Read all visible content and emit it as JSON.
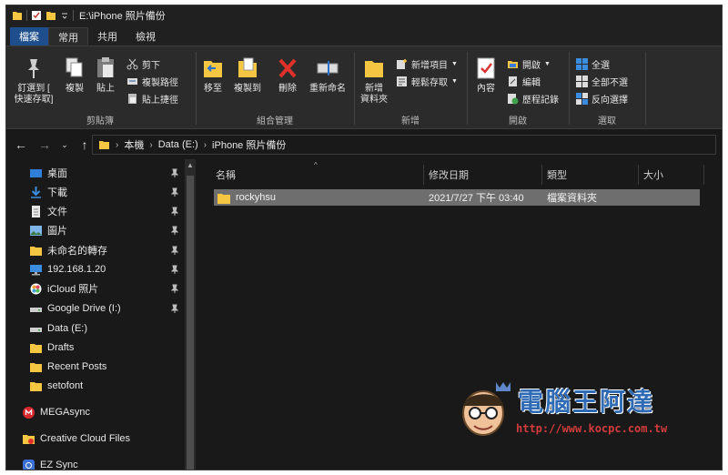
{
  "window": {
    "title": "E:\\iPhone 照片備份"
  },
  "tabs": [
    {
      "label": "檔案",
      "state": "file"
    },
    {
      "label": "常用",
      "state": "active"
    },
    {
      "label": "共用",
      "state": "normal"
    },
    {
      "label": "檢視",
      "state": "normal"
    }
  ],
  "ribbon": {
    "clipboard": {
      "pin_label_1": "釘選到 [",
      "pin_label_2": "快速存取]",
      "copy_label": "複製",
      "paste_label": "貼上",
      "cut_label": "剪下",
      "copy_path_label": "複製路徑",
      "paste_shortcut_label": "貼上捷徑",
      "group_label": "剪貼簿"
    },
    "organize": {
      "move_to_label": "移至",
      "copy_to_label": "複製到",
      "delete_label": "刪除",
      "rename_label": "重新命名",
      "group_label": "組合管理"
    },
    "new": {
      "new_folder_label_1": "新增",
      "new_folder_label_2": "資料夾",
      "new_item_label": "新增項目",
      "easy_access_label": "輕鬆存取",
      "group_label": "新增"
    },
    "open": {
      "properties_label": "內容",
      "open_label": "開啟",
      "edit_label": "編輯",
      "history_label": "歷程記錄",
      "group_label": "開啟"
    },
    "select": {
      "select_all_label": "全選",
      "select_none_label": "全部不選",
      "invert_label": "反向選擇",
      "group_label": "選取"
    }
  },
  "address": {
    "crumbs": [
      "本機",
      "Data (E:)",
      "iPhone 照片備份"
    ]
  },
  "navpane": {
    "items": [
      {
        "label": "桌面",
        "icon": "desktop-icon",
        "pinned": true
      },
      {
        "label": "下載",
        "icon": "download-icon",
        "pinned": true
      },
      {
        "label": "文件",
        "icon": "document-icon",
        "pinned": true
      },
      {
        "label": "圖片",
        "icon": "picture-icon",
        "pinned": true
      },
      {
        "label": "未命名的轉存",
        "icon": "folder-icon",
        "pinned": true
      },
      {
        "label": "192.168.1.20",
        "icon": "network-drive-icon",
        "pinned": true
      },
      {
        "label": "iCloud 照片",
        "icon": "icloud-photos-icon",
        "pinned": true
      },
      {
        "label": "Google Drive (I:)",
        "icon": "drive-icon",
        "pinned": true
      },
      {
        "label": "Data (E:)",
        "icon": "drive-icon",
        "pinned": false
      },
      {
        "label": "Drafts",
        "icon": "folder-icon",
        "pinned": false
      },
      {
        "label": "Recent Posts",
        "icon": "folder-icon",
        "pinned": false
      },
      {
        "label": "setofont",
        "icon": "folder-icon",
        "pinned": false
      },
      {
        "label": "MEGAsync",
        "icon": "mega-icon",
        "pinned": false
      },
      {
        "label": "Creative Cloud Files",
        "icon": "creative-cloud-icon",
        "pinned": false
      },
      {
        "label": "EZ Sync",
        "icon": "ez-sync-icon",
        "pinned": false
      }
    ]
  },
  "columns": {
    "name": "名稱",
    "modified": "修改日期",
    "type": "類型",
    "size": "大小"
  },
  "files": [
    {
      "name": "rockyhsu",
      "modified": "2021/7/27 下午 03:40",
      "type": "檔案資料夾",
      "size": ""
    }
  ],
  "watermark": {
    "title": "電腦王阿達",
    "url": "http://www.kocpc.com.tw"
  },
  "colors": {
    "background": "#191919",
    "ribbon": "#2b2b2b",
    "file_tab": "#1e4f8c",
    "folder": "#f5c642",
    "selection": "#6e6e6e"
  }
}
